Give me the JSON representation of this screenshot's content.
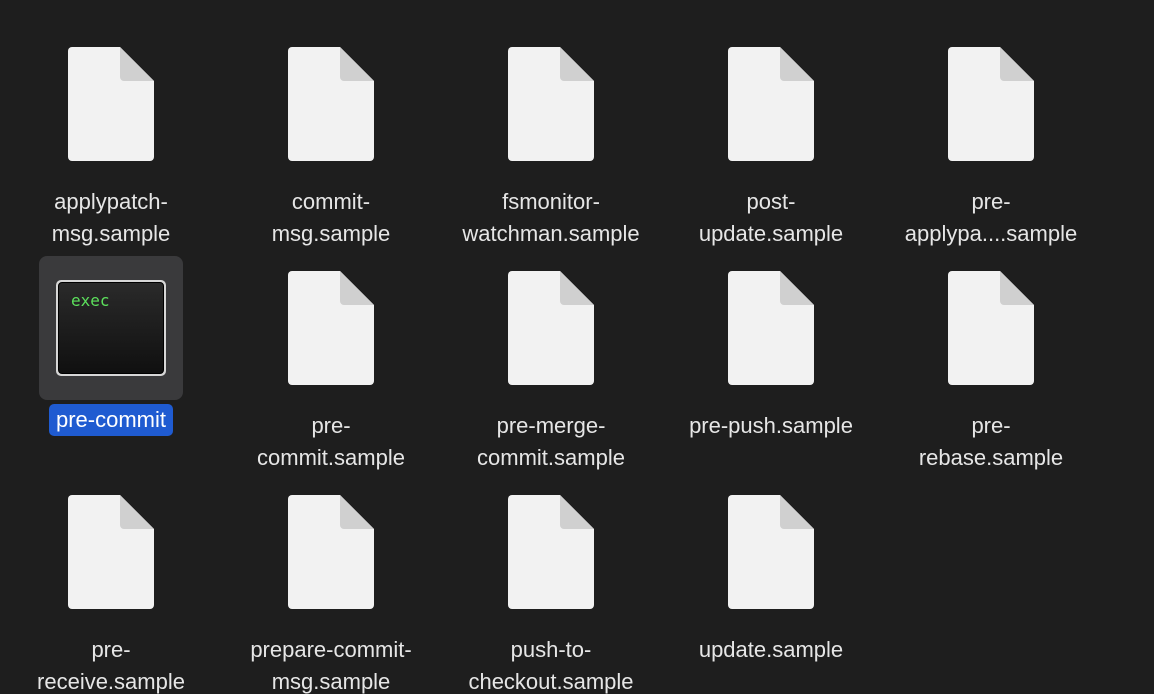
{
  "files": [
    {
      "line1": "applypatch-",
      "line2": "msg.sample",
      "icon": "document-icon"
    },
    {
      "line1": "commit-",
      "line2": "msg.sample",
      "icon": "document-icon"
    },
    {
      "line1": "fsmonitor-",
      "line2": "watchman.sample",
      "icon": "document-icon"
    },
    {
      "line1": "post-",
      "line2": "update.sample",
      "icon": "document-icon"
    },
    {
      "line1": "pre-",
      "line2": "applypa....sample",
      "icon": "document-icon"
    },
    {
      "line1": "pre-commit",
      "line2": "",
      "icon": "terminal-exec-icon",
      "icon_text": "exec",
      "selected": true
    },
    {
      "line1": "pre-",
      "line2": "commit.sample",
      "icon": "document-icon"
    },
    {
      "line1": "pre-merge-",
      "line2": "commit.sample",
      "icon": "document-icon"
    },
    {
      "line1": "pre-push.sample",
      "line2": "",
      "icon": "document-icon"
    },
    {
      "line1": "pre-",
      "line2": "rebase.sample",
      "icon": "document-icon"
    },
    {
      "line1": "pre-",
      "line2": "receive.sample",
      "icon": "document-icon"
    },
    {
      "line1": "prepare-commit-",
      "line2": "msg.sample",
      "icon": "document-icon"
    },
    {
      "line1": "push-to-",
      "line2": "checkout.sample",
      "icon": "document-icon"
    },
    {
      "line1": "update.sample",
      "line2": "",
      "icon": "document-icon"
    }
  ],
  "colors": {
    "background": "#1e1e1e",
    "selection": "#1f5bd1",
    "label": "#e6e6e6",
    "exec_text": "#5ce05c"
  }
}
